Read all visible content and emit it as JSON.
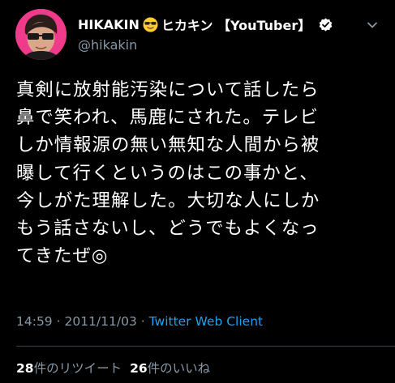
{
  "user": {
    "name": "HIKAKIN",
    "name_suffix": "ヒカキン 【YouTuber】",
    "handle": "@hikakin",
    "name_emoji": "smiling-face-with-sunglasses-icon",
    "verified_icon": "verified-badge-icon",
    "more_icon": "chevron-down-icon"
  },
  "tweet": {
    "text": "真剣に放射能汚染について話したら\n鼻で笑われ、馬鹿にされた。テレビ\nしか情報源の無い無知な人間から被\n曝して行くというのはこの事かと、\n今しがた理解した。大切な人にしか\nもう話さないし、どうでもよくなっ\nてきたぜ◎",
    "time": "14:59",
    "separator": "·",
    "date": "2011/11/03",
    "client": "Twitter Web Client"
  },
  "stats": {
    "retweets_count": "28",
    "retweets_label": "件のリツイート",
    "likes_count": "26",
    "likes_label": "件のいいね"
  },
  "colors": {
    "background": "#000000",
    "text": "#ffffff",
    "muted": "#8899a6",
    "link": "#1da1f2",
    "avatar_bg": "#f03a8a"
  }
}
